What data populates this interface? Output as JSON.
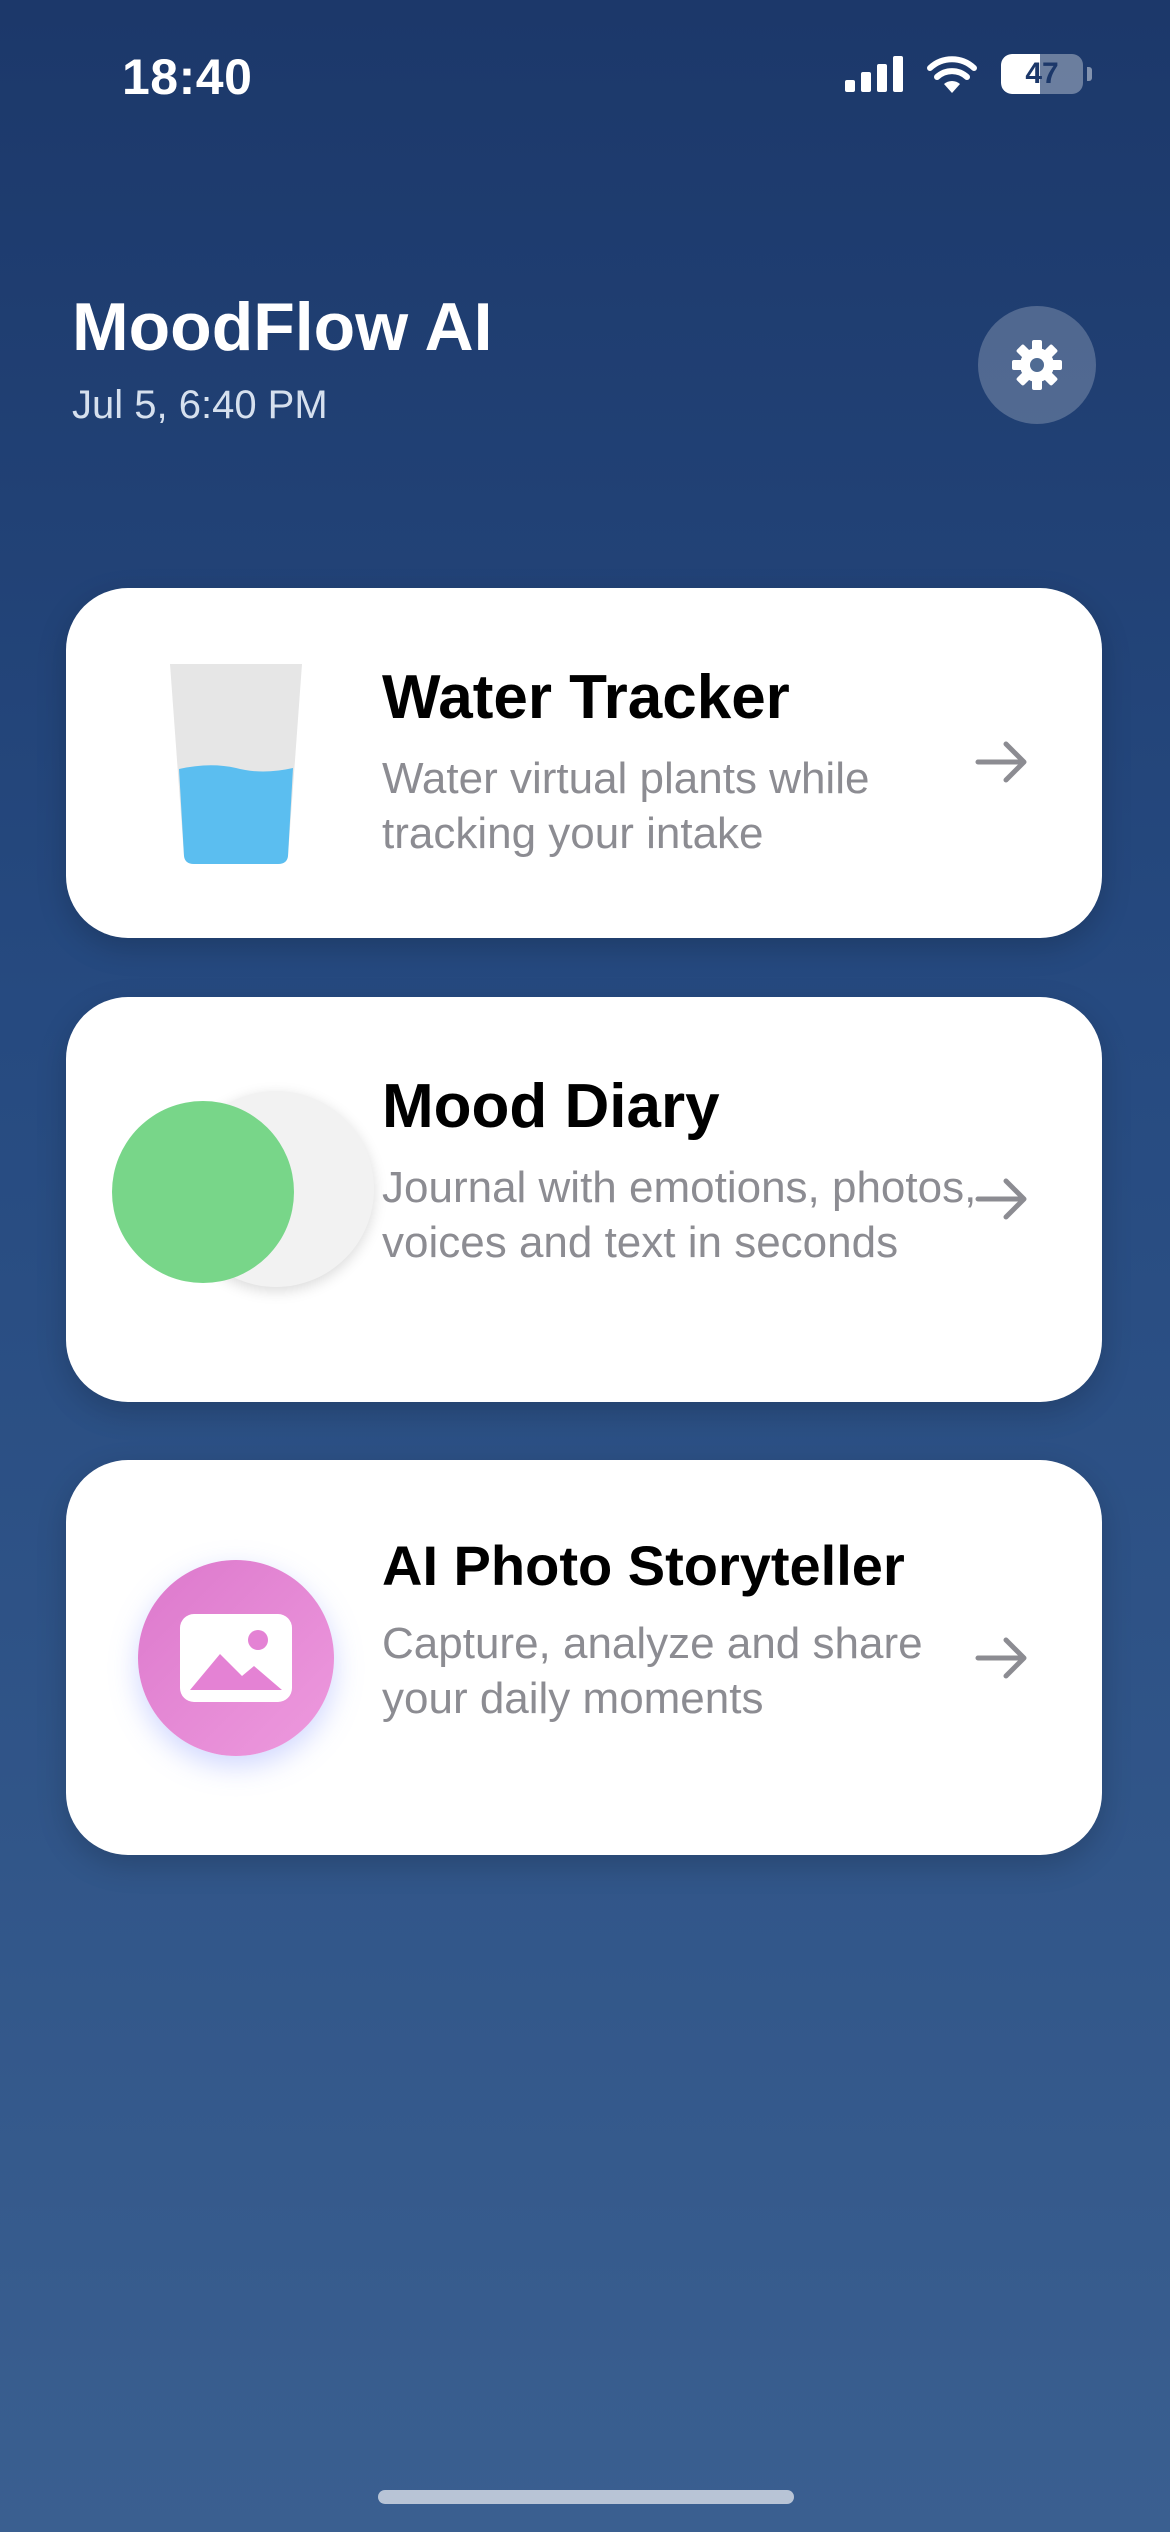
{
  "status_bar": {
    "time": "18:40",
    "battery_level": "47",
    "signal_icon": "cellular-signal-icon",
    "wifi_icon": "wifi-icon"
  },
  "header": {
    "title": "MoodFlow AI",
    "date": "Jul 5, 6:40 PM",
    "settings_icon": "gear-icon"
  },
  "cards": [
    {
      "title": "Water Tracker",
      "description": "Water virtual plants while tracking your intake",
      "icon": "water-glass-icon",
      "accent": "#5bbef0"
    },
    {
      "title": "Mood Diary",
      "description": "Journal with emotions, photos, voices and text in seconds",
      "icon": "mood-circle-icon",
      "accent": "#78d689"
    },
    {
      "title": "AI Photo Storyteller",
      "description": "Capture, analyze and share your daily moments",
      "icon": "photo-icon",
      "accent": "#e07fcf"
    }
  ],
  "colors": {
    "background_top": "#1c386a",
    "background_bottom": "#3a5f90",
    "card": "#ffffff",
    "secondary_text": "#8c8c92"
  }
}
